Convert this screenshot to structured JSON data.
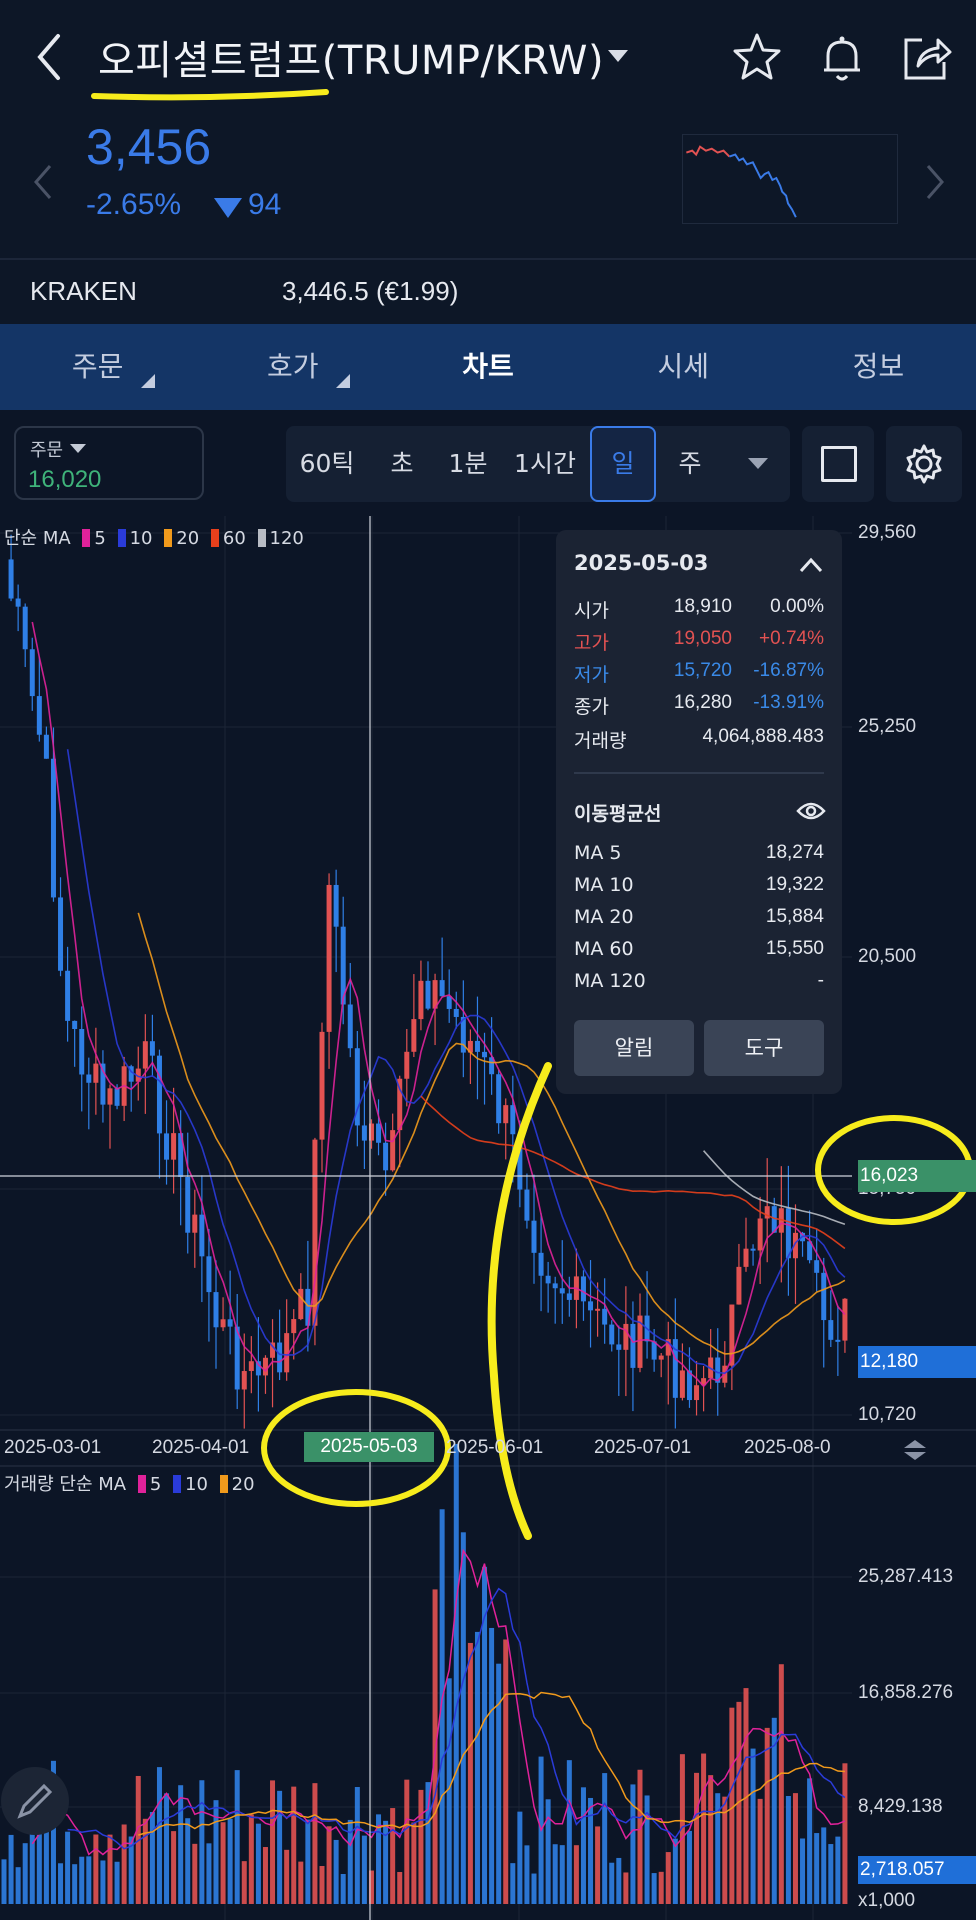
{
  "header": {
    "title": "오피셜트럼프(TRUMP/KRW)",
    "price": "3,456",
    "change_pct": "-2.65%",
    "change_abs": "94",
    "colors": {
      "down": "#3a7be8",
      "up": "#e25252",
      "accent": "#3fb37a"
    }
  },
  "reference": {
    "exchange": "KRAKEN",
    "value": "3,446.5 (€1.99)"
  },
  "tabs": [
    {
      "label": "주문"
    },
    {
      "label": "호가"
    },
    {
      "label": "차트"
    },
    {
      "label": "시세"
    },
    {
      "label": "정보"
    }
  ],
  "toolbar": {
    "order_label": "주문",
    "order_value": "16,020",
    "periods": [
      {
        "label": "60틱"
      },
      {
        "label": "초"
      },
      {
        "label": "1분"
      },
      {
        "label": "1시간"
      },
      {
        "label": "일"
      },
      {
        "label": "주"
      }
    ],
    "selected_period": "일"
  },
  "chart": {
    "legend_price": {
      "prefix": "단순 MA",
      "items": [
        "5",
        "10",
        "20",
        "60",
        "120"
      ]
    },
    "legend_volume": {
      "prefix": "거래량 단순 MA",
      "items": [
        "5",
        "10",
        "20"
      ]
    },
    "ma_colors": [
      "#e0229a",
      "#2a3bd9",
      "#f19a1c",
      "#e8401c",
      "#b8bcc4"
    ],
    "price_axis": [
      "29,560",
      "25,250",
      "20,500",
      "15,750",
      "10,720"
    ],
    "volume_axis": [
      "25,287.413",
      "16,858.276",
      "8,429.138",
      "x1,000"
    ],
    "date_axis": [
      "2025-03-01",
      "2025-04-01",
      "2025-06-01",
      "2025-07-01",
      "2025-08-0"
    ],
    "crosshair_date": "2025-05-03",
    "crosshair_price": "16,023",
    "current_price_tag": "12,180",
    "volume_tag": "2,718.057"
  },
  "info_panel": {
    "date": "2025-05-03",
    "rows": [
      {
        "label": "시가",
        "value": "18,910",
        "pct": "0.00%"
      },
      {
        "label": "고가",
        "value": "19,050",
        "pct": "+0.74%"
      },
      {
        "label": "저가",
        "value": "15,720",
        "pct": "-16.87%"
      },
      {
        "label": "종가",
        "value": "16,280",
        "pct": "-13.91%"
      }
    ],
    "volume_label": "거래량",
    "volume_value": "4,064,888.483",
    "ma_title": "이동평균선",
    "ma_rows": [
      {
        "label": "MA 5",
        "value": "18,274"
      },
      {
        "label": "MA 10",
        "value": "19,322"
      },
      {
        "label": "MA 20",
        "value": "15,884"
      },
      {
        "label": "MA 60",
        "value": "15,550"
      },
      {
        "label": "MA 120",
        "value": "-"
      }
    ],
    "alert_button": "알림",
    "tool_button": "도구"
  }
}
